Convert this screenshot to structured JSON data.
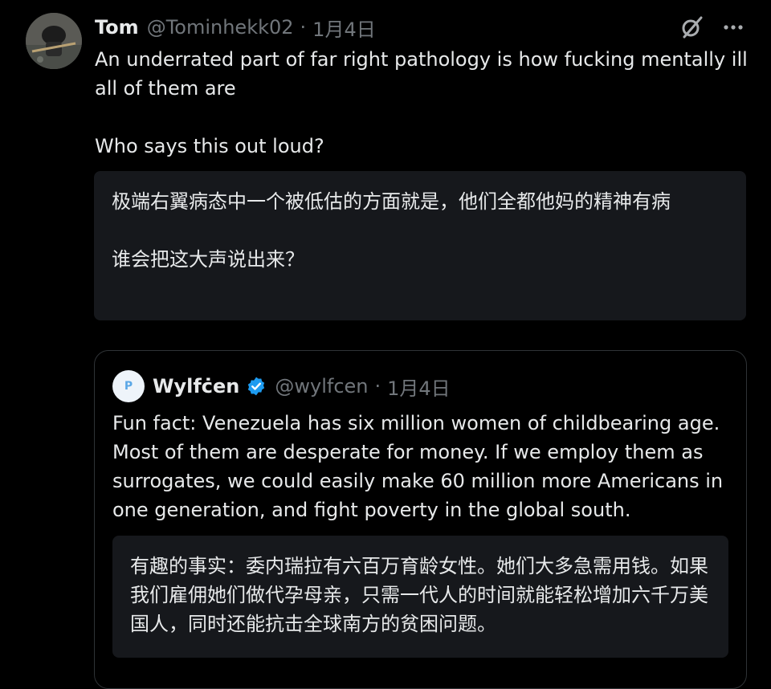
{
  "tweet": {
    "author_name": "Tom",
    "handle": "@Tominhekk02",
    "separator": "·",
    "date": "1月4日",
    "text": "An underrated part of far right pathology is how fucking mentally ill all of them are\n\nWho says this out loud?",
    "translation": "极端右翼病态中一个被低估的方面就是，他们全都他妈的精神有病\n\n谁会把这大声说出来？",
    "icons": [
      "grok-icon",
      "more-icon"
    ]
  },
  "quoted_tweet": {
    "author_name": "Wylfċen",
    "handle": "@wylfcen",
    "separator": "·",
    "date": "1月4日",
    "avatar_letter": "P",
    "verified": true,
    "text": "Fun fact: Venezuela has six million women of childbearing age. Most of them are desperate for money. If we employ them as surrogates, we could easily make 60 million more Americans in one generation, and fight poverty in the global south.",
    "translation": "有趣的事实：委内瑞拉有六百万育龄女性。她们大多急需用钱。如果我们雇佣她们做代孕母亲，只需一代人的时间就能轻松增加六千万美国人，同时还能抗击全球南方的贫困问题。"
  },
  "colors": {
    "background": "#000000",
    "text": "#e7e9ea",
    "muted": "#71767b",
    "translation_bg": "#16181c",
    "border": "#2f3336",
    "verified_badge": "#1d9bf0"
  }
}
